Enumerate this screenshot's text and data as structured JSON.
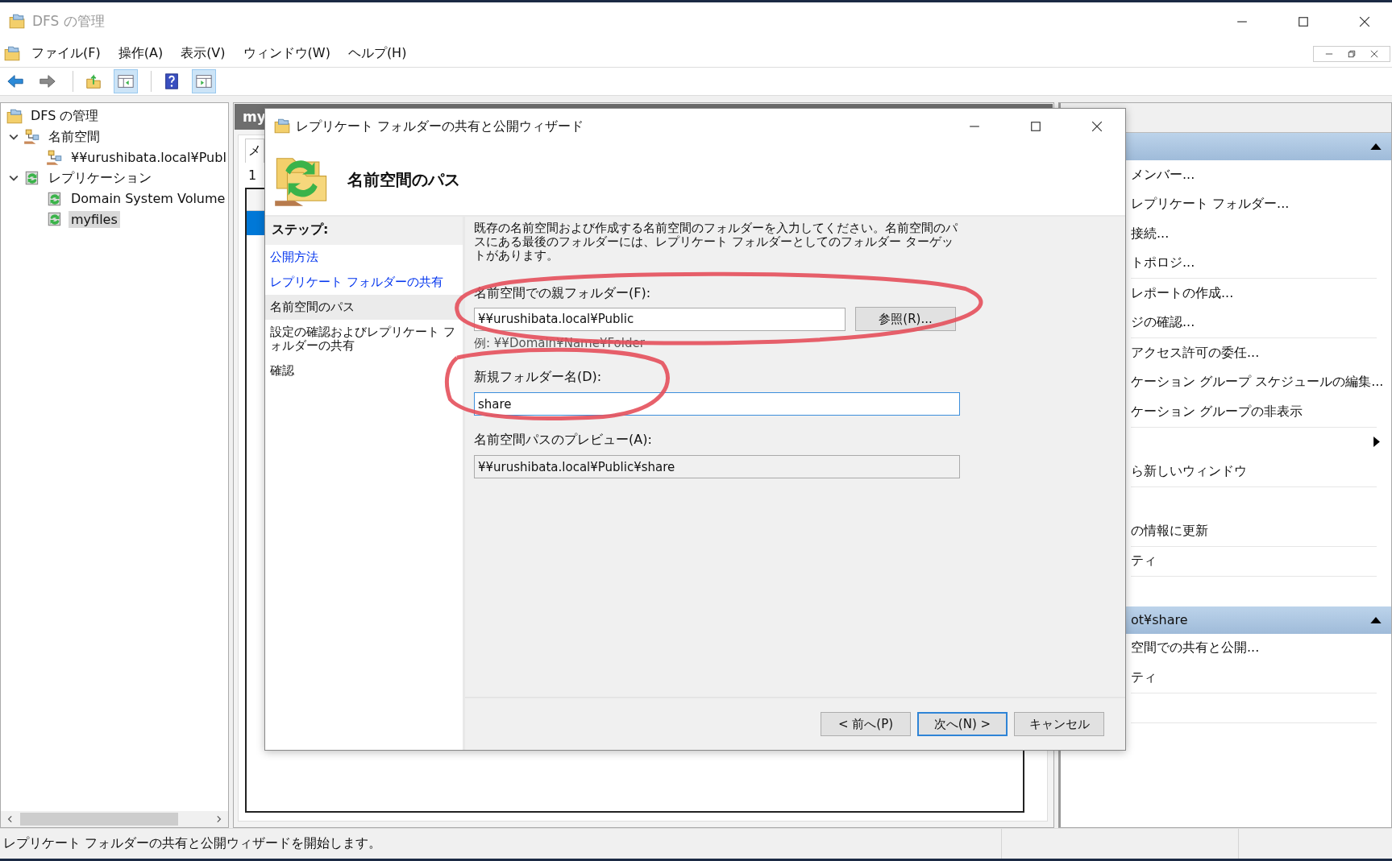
{
  "window": {
    "title": "DFS の管理"
  },
  "menu": [
    "ファイル(F)",
    "操作(A)",
    "表示(V)",
    "ウィンドウ(W)",
    "ヘルプ(H)"
  ],
  "toolbar": [
    {
      "kind": "back",
      "on": false
    },
    {
      "kind": "forward",
      "on": false
    },
    {
      "kind": "separator"
    },
    {
      "kind": "up",
      "on": false
    },
    {
      "kind": "tree_toggle",
      "on": true
    },
    {
      "kind": "separator"
    },
    {
      "kind": "help",
      "on": false
    },
    {
      "kind": "action_toggle",
      "on": true
    }
  ],
  "tree": {
    "label": "DFS の管理",
    "kind": "root",
    "selected": false,
    "children": [
      {
        "label": "名前空間",
        "kind": "namespaces",
        "selected": false,
        "expanded": true,
        "children": [
          {
            "label": "¥¥urushibata.local¥Publ",
            "kind": "namespace",
            "selected": false
          }
        ]
      },
      {
        "label": "レプリケーション",
        "kind": "replication",
        "selected": false,
        "expanded": true,
        "children": [
          {
            "label": "Domain System Volume",
            "kind": "group",
            "selected": false
          },
          {
            "label": "myfiles",
            "kind": "group",
            "selected": true
          }
        ]
      }
    ]
  },
  "middle": {
    "header": "my",
    "tab": "メ",
    "row_number": "1"
  },
  "dialog": {
    "title": "レプリケート フォルダーの共有と公開ウィザード",
    "heading": "名前空間のパス",
    "steps_heading": "ステップ:",
    "steps": [
      {
        "label": "公開方法",
        "completed": true,
        "selected": false
      },
      {
        "label": "レプリケート フォルダーの共有",
        "completed": true,
        "selected": false
      },
      {
        "label": "名前空間のパス",
        "completed": false,
        "selected": true
      },
      {
        "label": "設定の確認およびレプリケート フォルダーの共有",
        "completed": false,
        "selected": false
      },
      {
        "label": "確認",
        "completed": false,
        "selected": false
      }
    ],
    "description": "既存の名前空間および作成する名前空間のフォルダーを入力してください。名前空間のパスにある最後のフォルダーには、レプリケート フォルダーとしてのフォルダー ターゲットがあります。",
    "parent_folder": {
      "label": "名前空間での親フォルダー(F):",
      "value": "¥¥urushibata.local¥Public",
      "browse_button": "参照(R)...",
      "example": "例: ¥¥Domain¥Name¥Folder",
      "circled": true
    },
    "new_folder": {
      "label": "新規フォルダー名(D):",
      "value": "share",
      "focused": true,
      "circled": true
    },
    "preview": {
      "label": "名前空間パスのプレビュー(A):",
      "value": "¥¥urushibata.local¥Public¥share"
    },
    "buttons": [
      {
        "label": "< 前へ(P)",
        "default": false
      },
      {
        "label": "次へ(N) >",
        "default": true
      },
      {
        "label": "キャンセル",
        "default": false
      }
    ]
  },
  "actions": {
    "sections": [
      {
        "items": [
          {
            "kind": "action",
            "label": "メンバー..."
          },
          {
            "kind": "action",
            "label": "レプリケート フォルダー..."
          },
          {
            "kind": "action",
            "label": "接続..."
          },
          {
            "kind": "action",
            "label": "トポロジ..."
          },
          {
            "kind": "separator"
          },
          {
            "kind": "action",
            "label": "レポートの作成..."
          },
          {
            "kind": "action",
            "label": "ジの確認..."
          },
          {
            "kind": "separator"
          },
          {
            "kind": "action",
            "label": "アクセス許可の委任..."
          },
          {
            "kind": "action",
            "label": "ケーション グループ スケジュールの編集..."
          },
          {
            "kind": "action",
            "label": "ケーション グループの非表示"
          },
          {
            "kind": "separator"
          },
          {
            "kind": "submenu"
          },
          {
            "kind": "action",
            "label": "ら新しいウィンドウ"
          },
          {
            "kind": "separator"
          },
          {
            "kind": "blank"
          },
          {
            "kind": "action",
            "label": "の情報に更新"
          },
          {
            "kind": "separator"
          },
          {
            "kind": "action",
            "label": "ティ"
          },
          {
            "kind": "separator"
          },
          {
            "kind": "blank"
          }
        ]
      },
      {
        "title": "ot¥share",
        "items": [
          {
            "kind": "action",
            "label": "空間での共有と公開..."
          },
          {
            "kind": "action",
            "label": "ティ"
          },
          {
            "kind": "separator"
          },
          {
            "kind": "blank"
          },
          {
            "kind": "separator"
          },
          {
            "kind": "icon_only"
          }
        ]
      }
    ]
  },
  "status_bar": {
    "text": "レプリケート フォルダーの共有と公開ウィザードを開始します。"
  }
}
